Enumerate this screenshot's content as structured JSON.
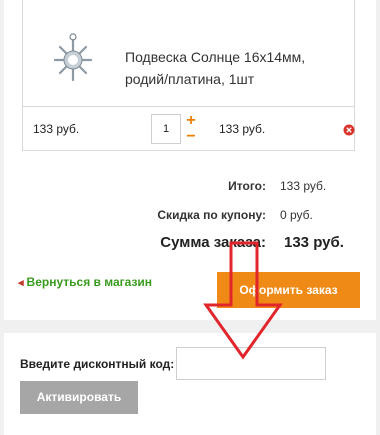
{
  "cart": {
    "item": {
      "name": "Подвеска Солнце 16х14мм, родий/платина, 1шт",
      "unit_price": "133 руб.",
      "quantity": "1",
      "plus": "+",
      "minus": "−",
      "total_price": "133 руб."
    }
  },
  "summary": {
    "total_label": "Итого:",
    "total_value": "133 руб.",
    "discount_label": "Скидка по купону:",
    "discount_value": "0 руб.",
    "sum_label": "Сумма заказа:",
    "sum_value": "133 руб."
  },
  "actions": {
    "back_arrow": "◂",
    "back_label": "Вернуться в магазин",
    "checkout_label": "Оформить заказ"
  },
  "coupon": {
    "label": "Введите дисконтный код:",
    "input_value": "",
    "activate_label": "Активировать"
  },
  "colors": {
    "accent_orange": "#f08a16",
    "link_green": "#3a9a1f",
    "annotation_red": "#e0252b",
    "button_gray": "#a6a6a6"
  },
  "icons": {
    "remove": "remove-circle-icon",
    "annotation": "down-arrow-icon"
  }
}
